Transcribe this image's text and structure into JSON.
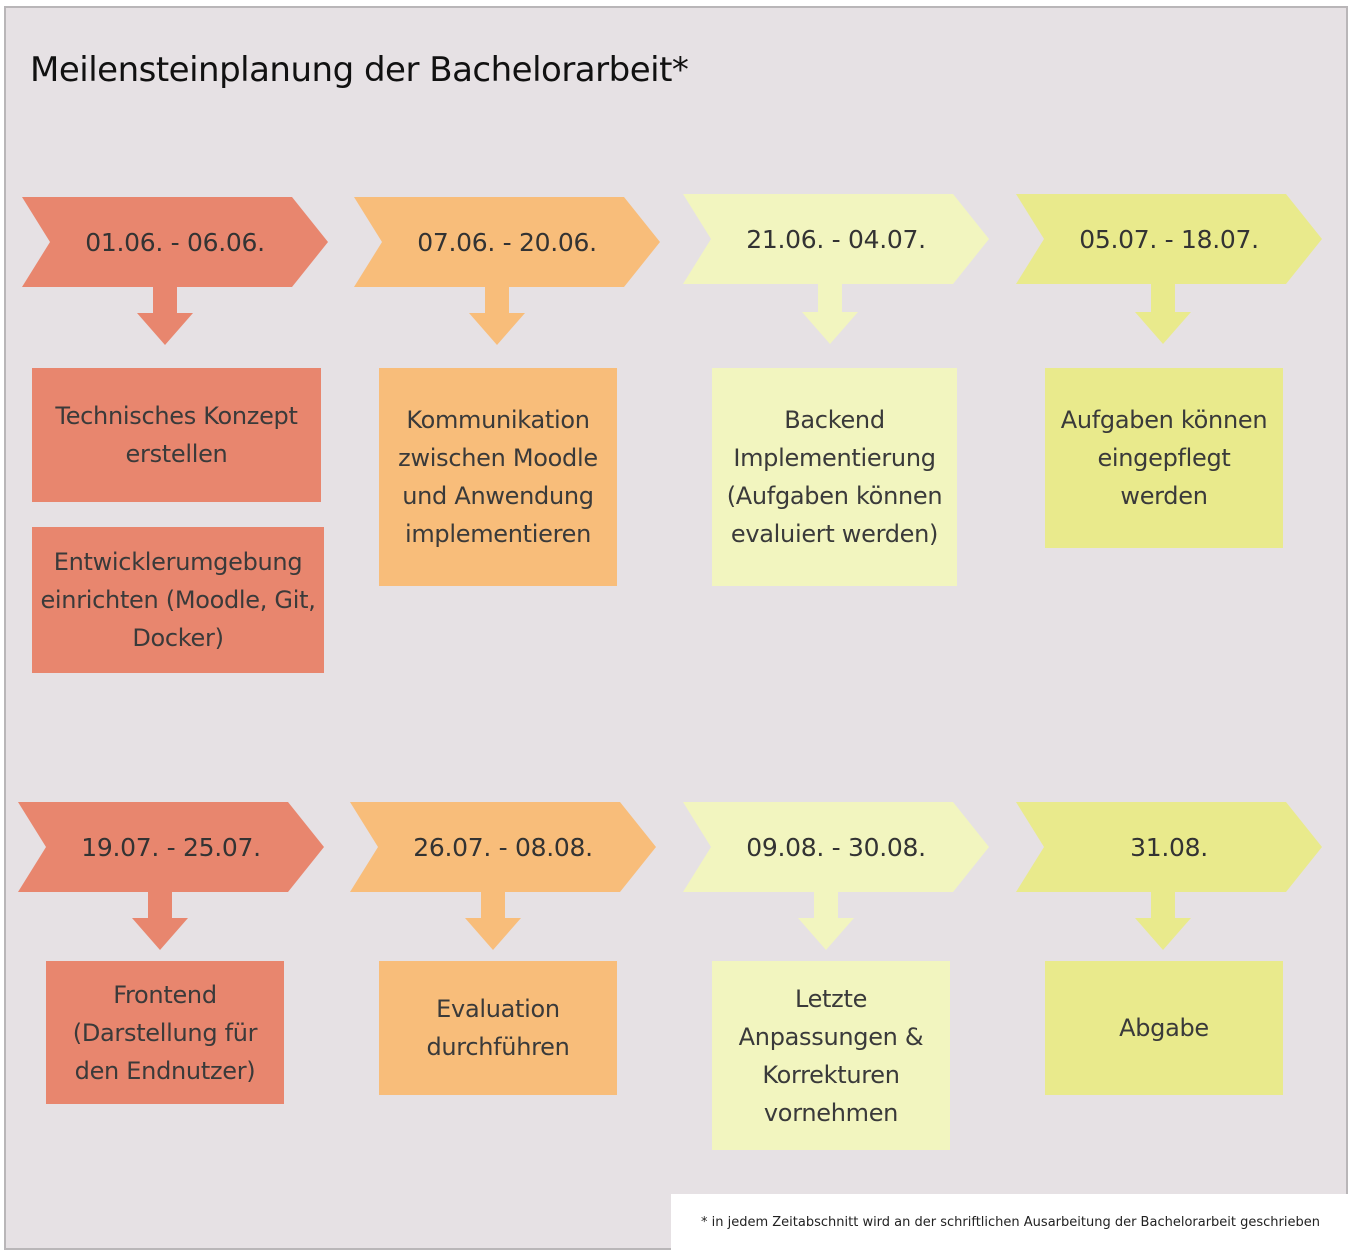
{
  "title": "Meilensteinplanung der Bachelorarbeit*",
  "colors": {
    "phase1": "#e8866e",
    "phase2": "#f8bd7a",
    "phase3": "#f2f5bf",
    "phase4": "#e9ea8c",
    "background": "#e6e1e4"
  },
  "rows": [
    {
      "milestones": [
        {
          "period": "01.06. - 06.06.",
          "tasks": [
            "Technisches Konzept erstellen",
            "Entwicklerumgebung einrichten (Moodle, Git, Docker)"
          ]
        },
        {
          "period": "07.06. - 20.06.",
          "tasks": [
            "Kommunikation zwischen Moodle und Anwendung implementieren"
          ]
        },
        {
          "period": "21.06. - 04.07.",
          "tasks": [
            "Backend Implementierung (Aufgaben können evaluiert werden)"
          ]
        },
        {
          "period": "05.07. - 18.07.",
          "tasks": [
            "Aufgaben können eingepflegt werden"
          ]
        }
      ]
    },
    {
      "milestones": [
        {
          "period": "19.07. - 25.07.",
          "tasks": [
            "Frontend (Darstellung für den Endnutzer)"
          ]
        },
        {
          "period": "26.07. - 08.08.",
          "tasks": [
            "Evaluation durchführen"
          ]
        },
        {
          "period": "09.08. - 30.08.",
          "tasks": [
            "Letzte Anpassungen & Korrekturen vornehmen"
          ]
        },
        {
          "period": "31.08.",
          "tasks": [
            "Abgabe"
          ]
        }
      ]
    }
  ],
  "footnote": "* in jedem Zeitabschnitt wird an der schriftlichen Ausarbeitung der Bachelorarbeit geschrieben"
}
